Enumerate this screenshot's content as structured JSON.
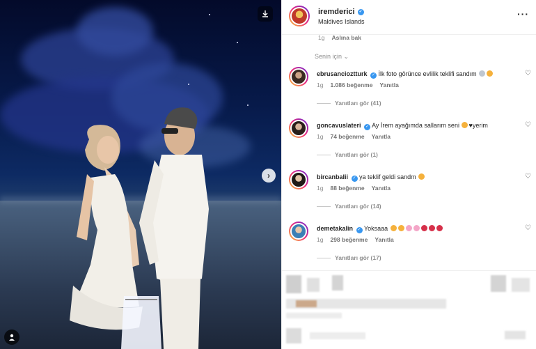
{
  "post": {
    "username": "iremderici",
    "location": "Maldives Islands",
    "time_ago": "1g",
    "see_translation": "Aslına bak",
    "sort_label": "Senin için"
  },
  "icons": {
    "save": "save-icon",
    "next": "chevron-right-icon",
    "tag": "user-tag-icon",
    "more": "more-horizontal-icon",
    "heart": "heart-icon",
    "verified": "verified-badge-icon"
  },
  "colors": {
    "verified": "#3897f0",
    "story_ring": "#ee2a7b"
  },
  "comments": [
    {
      "username": "ebrusancioztturk",
      "text": "İlk foto görünce evlilik teklifi sandım",
      "time": "1g",
      "likes": "1.086 beğenme",
      "reply": "Yanıtla",
      "view_replies": "Yanıtları gör (41)"
    },
    {
      "username": "goncavuslateri",
      "text": "Ay İrem ayağımda sallarım seni",
      "text_suffix": "yerim",
      "time": "1g",
      "likes": "74 beğenme",
      "reply": "Yanıtla",
      "view_replies": "Yanıtları gör (1)"
    },
    {
      "username": "bircanbalii",
      "text": "ya teklif geldi sandm",
      "time": "1g",
      "likes": "88 beğenme",
      "reply": "Yanıtla",
      "view_replies": "Yanıtları gör (14)"
    },
    {
      "username": "demetakalin",
      "text": "Yoksaaa",
      "time": "1g",
      "likes": "298 beğenme",
      "reply": "Yanıtla",
      "view_replies": "Yanıtları gör (17)"
    }
  ]
}
